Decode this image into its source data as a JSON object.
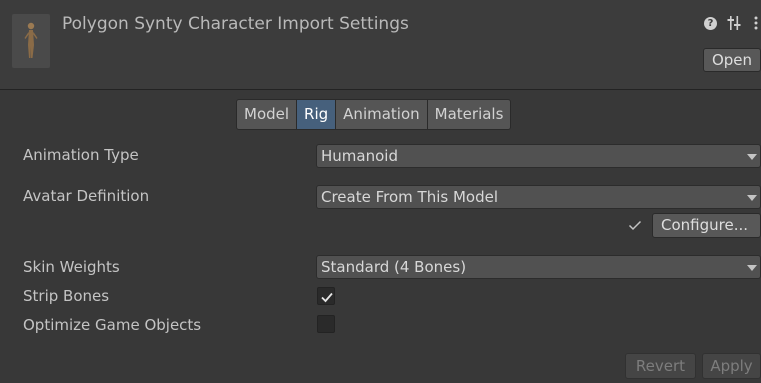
{
  "header": {
    "title": "Polygon Synty Character Import Settings",
    "help_icon": "?",
    "open_label": "Open"
  },
  "tabs": [
    {
      "label": "Model",
      "active": false
    },
    {
      "label": "Rig",
      "active": true
    },
    {
      "label": "Animation",
      "active": false
    },
    {
      "label": "Materials",
      "active": false
    }
  ],
  "rig": {
    "animation_type": {
      "label": "Animation Type",
      "value": "Humanoid"
    },
    "avatar_definition": {
      "label": "Avatar Definition",
      "value": "Create From This Model"
    },
    "configure_label": "Configure...",
    "skin_weights": {
      "label": "Skin Weights",
      "value": "Standard (4 Bones)"
    },
    "strip_bones": {
      "label": "Strip Bones",
      "checked": true
    },
    "optimize_game_objects": {
      "label": "Optimize Game Objects",
      "checked": false
    }
  },
  "footer": {
    "revert_label": "Revert",
    "apply_label": "Apply"
  },
  "colors": {
    "background": "#383838",
    "tab_active": "#46607c",
    "button": "#585858"
  },
  "icons": {
    "thumbnail": "character-model-icon",
    "help": "help-icon",
    "preset": "preset-sliders-icon",
    "menu": "kebab-menu-icon",
    "configured": "check-mark-icon"
  }
}
